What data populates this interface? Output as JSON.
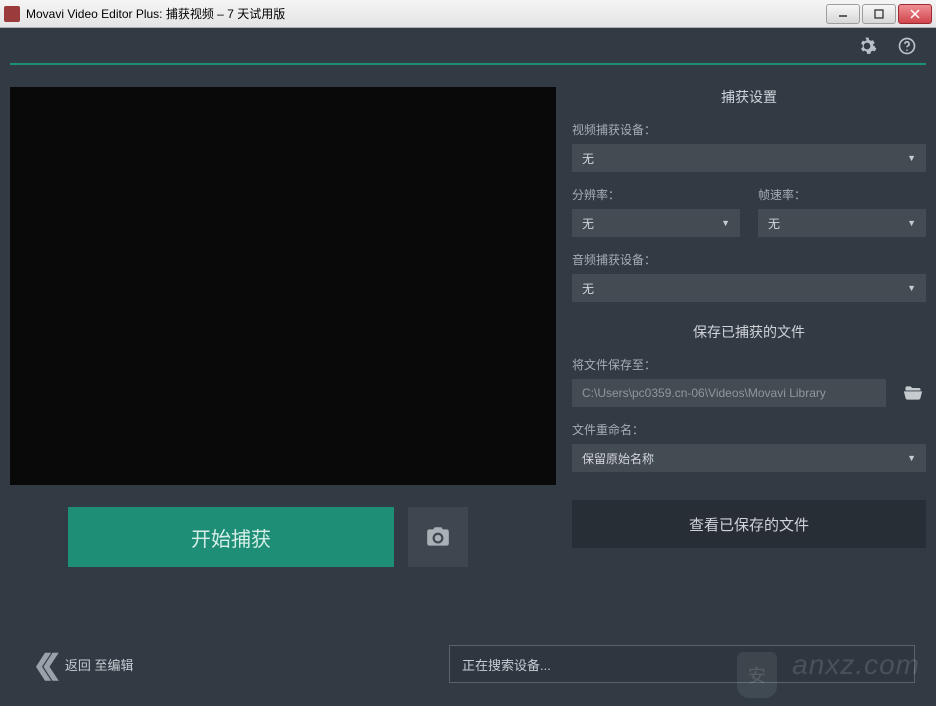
{
  "window": {
    "title": "Movavi Video Editor Plus: 捕获视频 – 7 天试用版"
  },
  "capture": {
    "section_title": "捕获设置",
    "video_device_label": "视频捕获设备：",
    "video_device_value": "无",
    "resolution_label": "分辨率：",
    "resolution_value": "无",
    "fps_label": "帧速率：",
    "fps_value": "无",
    "audio_device_label": "音频捕获设备：",
    "audio_device_value": "无"
  },
  "save": {
    "section_title": "保存已捕获的文件",
    "save_to_label": "将文件保存至：",
    "save_to_value": "C:\\Users\\pc0359.cn-06\\Videos\\Movavi Library",
    "rename_label": "文件重命名：",
    "rename_value": "保留原始名称",
    "view_saved_label": "查看已保存的文件"
  },
  "buttons": {
    "start_capture": "开始捕获"
  },
  "status": {
    "text": "正在搜索设备..."
  },
  "back": {
    "label": "返回 至编辑"
  },
  "watermark": {
    "shield": "安",
    "text": "anxz.com"
  }
}
